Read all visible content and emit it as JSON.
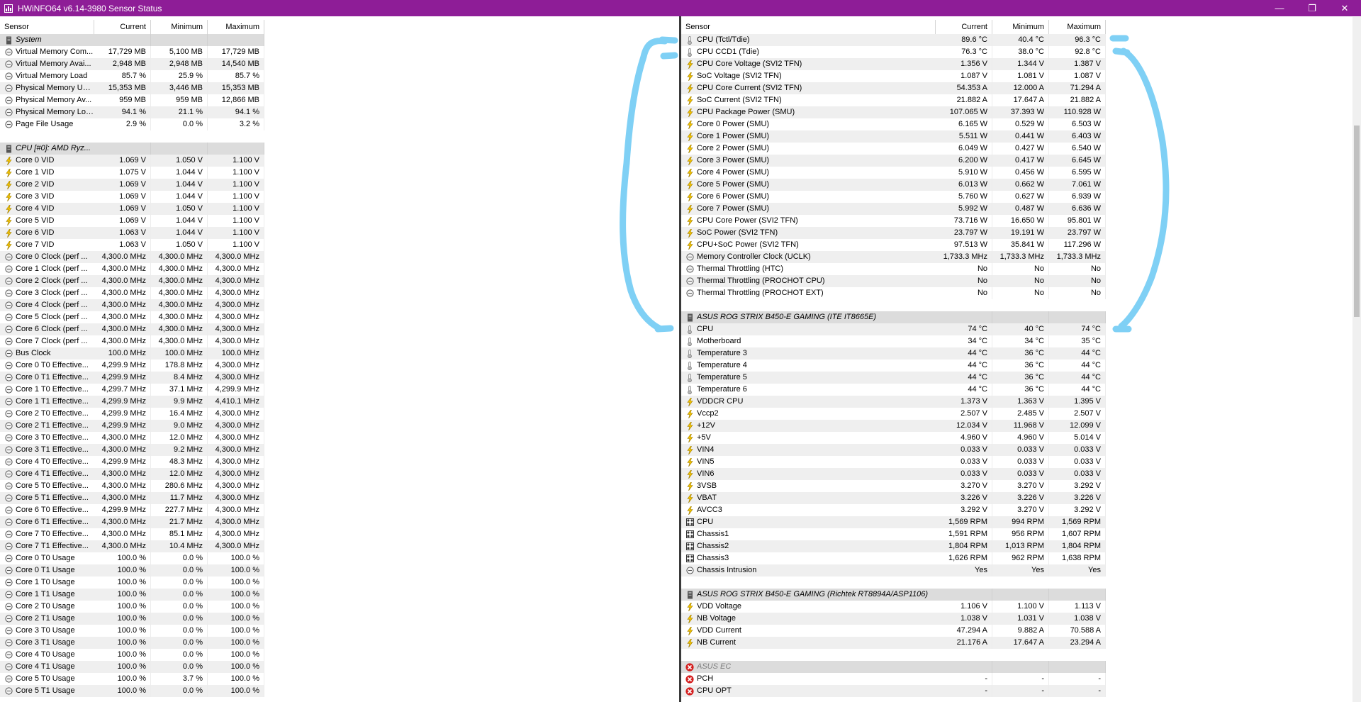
{
  "window": {
    "title": "HWiNFO64 v6.14-3980 Sensor Status"
  },
  "columns": {
    "sensor": "Sensor",
    "current": "Current",
    "minimum": "Minimum",
    "maximum": "Maximum"
  },
  "icon_names": {
    "mem": "memory-sensor-icon",
    "volt": "voltage-icon",
    "temp": "thermometer-icon",
    "fan": "fan-icon",
    "group": "sensor-group-icon",
    "err": "error-icon"
  },
  "left_rows": [
    {
      "type": "group",
      "label": "System"
    },
    {
      "icon": "mem",
      "label": "Virtual Memory Com...",
      "cur": "17,729 MB",
      "min": "5,100 MB",
      "max": "17,729 MB"
    },
    {
      "icon": "mem",
      "label": "Virtual Memory Avai...",
      "cur": "2,948 MB",
      "min": "2,948 MB",
      "max": "14,540 MB"
    },
    {
      "icon": "mem",
      "label": "Virtual Memory Load",
      "cur": "85.7 %",
      "min": "25.9 %",
      "max": "85.7 %"
    },
    {
      "icon": "mem",
      "label": "Physical Memory Used",
      "cur": "15,353 MB",
      "min": "3,446 MB",
      "max": "15,353 MB"
    },
    {
      "icon": "mem",
      "label": "Physical Memory Av...",
      "cur": "959 MB",
      "min": "959 MB",
      "max": "12,866 MB"
    },
    {
      "icon": "mem",
      "label": "Physical Memory Load",
      "cur": "94.1 %",
      "min": "21.1 %",
      "max": "94.1 %"
    },
    {
      "icon": "mem",
      "label": "Page File Usage",
      "cur": "2.9 %",
      "min": "0.0 %",
      "max": "3.2 %"
    },
    {
      "type": "spacer"
    },
    {
      "type": "group",
      "label": "CPU [#0]: AMD Ryz..."
    },
    {
      "icon": "volt",
      "label": "Core 0 VID",
      "cur": "1.069 V",
      "min": "1.050 V",
      "max": "1.100 V"
    },
    {
      "icon": "volt",
      "label": "Core 1 VID",
      "cur": "1.075 V",
      "min": "1.044 V",
      "max": "1.100 V"
    },
    {
      "icon": "volt",
      "label": "Core 2 VID",
      "cur": "1.069 V",
      "min": "1.044 V",
      "max": "1.100 V"
    },
    {
      "icon": "volt",
      "label": "Core 3 VID",
      "cur": "1.069 V",
      "min": "1.044 V",
      "max": "1.100 V"
    },
    {
      "icon": "volt",
      "label": "Core 4 VID",
      "cur": "1.069 V",
      "min": "1.050 V",
      "max": "1.100 V"
    },
    {
      "icon": "volt",
      "label": "Core 5 VID",
      "cur": "1.069 V",
      "min": "1.044 V",
      "max": "1.100 V"
    },
    {
      "icon": "volt",
      "label": "Core 6 VID",
      "cur": "1.063 V",
      "min": "1.044 V",
      "max": "1.100 V"
    },
    {
      "icon": "volt",
      "label": "Core 7 VID",
      "cur": "1.063 V",
      "min": "1.050 V",
      "max": "1.100 V"
    },
    {
      "icon": "mem",
      "label": "Core 0 Clock (perf ...",
      "cur": "4,300.0 MHz",
      "min": "4,300.0 MHz",
      "max": "4,300.0 MHz"
    },
    {
      "icon": "mem",
      "label": "Core 1 Clock (perf ...",
      "cur": "4,300.0 MHz",
      "min": "4,300.0 MHz",
      "max": "4,300.0 MHz"
    },
    {
      "icon": "mem",
      "label": "Core 2 Clock (perf ...",
      "cur": "4,300.0 MHz",
      "min": "4,300.0 MHz",
      "max": "4,300.0 MHz"
    },
    {
      "icon": "mem",
      "label": "Core 3 Clock (perf ...",
      "cur": "4,300.0 MHz",
      "min": "4,300.0 MHz",
      "max": "4,300.0 MHz"
    },
    {
      "icon": "mem",
      "label": "Core 4 Clock (perf ...",
      "cur": "4,300.0 MHz",
      "min": "4,300.0 MHz",
      "max": "4,300.0 MHz"
    },
    {
      "icon": "mem",
      "label": "Core 5 Clock (perf ...",
      "cur": "4,300.0 MHz",
      "min": "4,300.0 MHz",
      "max": "4,300.0 MHz"
    },
    {
      "icon": "mem",
      "label": "Core 6 Clock (perf ...",
      "cur": "4,300.0 MHz",
      "min": "4,300.0 MHz",
      "max": "4,300.0 MHz"
    },
    {
      "icon": "mem",
      "label": "Core 7 Clock (perf ...",
      "cur": "4,300.0 MHz",
      "min": "4,300.0 MHz",
      "max": "4,300.0 MHz"
    },
    {
      "icon": "mem",
      "label": "Bus Clock",
      "cur": "100.0 MHz",
      "min": "100.0 MHz",
      "max": "100.0 MHz"
    },
    {
      "icon": "mem",
      "label": "Core 0 T0 Effective...",
      "cur": "4,299.9 MHz",
      "min": "178.8 MHz",
      "max": "4,300.0 MHz"
    },
    {
      "icon": "mem",
      "label": "Core 0 T1 Effective...",
      "cur": "4,299.9 MHz",
      "min": "8.4 MHz",
      "max": "4,300.0 MHz"
    },
    {
      "icon": "mem",
      "label": "Core 1 T0 Effective...",
      "cur": "4,299.7 MHz",
      "min": "37.1 MHz",
      "max": "4,299.9 MHz"
    },
    {
      "icon": "mem",
      "label": "Core 1 T1 Effective...",
      "cur": "4,299.9 MHz",
      "min": "9.9 MHz",
      "max": "4,410.1 MHz"
    },
    {
      "icon": "mem",
      "label": "Core 2 T0 Effective...",
      "cur": "4,299.9 MHz",
      "min": "16.4 MHz",
      "max": "4,300.0 MHz"
    },
    {
      "icon": "mem",
      "label": "Core 2 T1 Effective...",
      "cur": "4,299.9 MHz",
      "min": "9.0 MHz",
      "max": "4,300.0 MHz"
    },
    {
      "icon": "mem",
      "label": "Core 3 T0 Effective...",
      "cur": "4,300.0 MHz",
      "min": "12.0 MHz",
      "max": "4,300.0 MHz"
    },
    {
      "icon": "mem",
      "label": "Core 3 T1 Effective...",
      "cur": "4,300.0 MHz",
      "min": "9.2 MHz",
      "max": "4,300.0 MHz"
    },
    {
      "icon": "mem",
      "label": "Core 4 T0 Effective...",
      "cur": "4,299.9 MHz",
      "min": "48.3 MHz",
      "max": "4,300.0 MHz"
    },
    {
      "icon": "mem",
      "label": "Core 4 T1 Effective...",
      "cur": "4,300.0 MHz",
      "min": "12.0 MHz",
      "max": "4,300.0 MHz"
    },
    {
      "icon": "mem",
      "label": "Core 5 T0 Effective...",
      "cur": "4,300.0 MHz",
      "min": "280.6 MHz",
      "max": "4,300.0 MHz"
    },
    {
      "icon": "mem",
      "label": "Core 5 T1 Effective...",
      "cur": "4,300.0 MHz",
      "min": "11.7 MHz",
      "max": "4,300.0 MHz"
    },
    {
      "icon": "mem",
      "label": "Core 6 T0 Effective...",
      "cur": "4,299.9 MHz",
      "min": "227.7 MHz",
      "max": "4,300.0 MHz"
    },
    {
      "icon": "mem",
      "label": "Core 6 T1 Effective...",
      "cur": "4,300.0 MHz",
      "min": "21.7 MHz",
      "max": "4,300.0 MHz"
    },
    {
      "icon": "mem",
      "label": "Core 7 T0 Effective...",
      "cur": "4,300.0 MHz",
      "min": "85.1 MHz",
      "max": "4,300.0 MHz"
    },
    {
      "icon": "mem",
      "label": "Core 7 T1 Effective...",
      "cur": "4,300.0 MHz",
      "min": "10.4 MHz",
      "max": "4,300.0 MHz"
    },
    {
      "icon": "mem",
      "label": "Core 0 T0 Usage",
      "cur": "100.0 %",
      "min": "0.0 %",
      "max": "100.0 %"
    },
    {
      "icon": "mem",
      "label": "Core 0 T1 Usage",
      "cur": "100.0 %",
      "min": "0.0 %",
      "max": "100.0 %"
    },
    {
      "icon": "mem",
      "label": "Core 1 T0 Usage",
      "cur": "100.0 %",
      "min": "0.0 %",
      "max": "100.0 %"
    },
    {
      "icon": "mem",
      "label": "Core 1 T1 Usage",
      "cur": "100.0 %",
      "min": "0.0 %",
      "max": "100.0 %"
    },
    {
      "icon": "mem",
      "label": "Core 2 T0 Usage",
      "cur": "100.0 %",
      "min": "0.0 %",
      "max": "100.0 %"
    },
    {
      "icon": "mem",
      "label": "Core 2 T1 Usage",
      "cur": "100.0 %",
      "min": "0.0 %",
      "max": "100.0 %"
    },
    {
      "icon": "mem",
      "label": "Core 3 T0 Usage",
      "cur": "100.0 %",
      "min": "0.0 %",
      "max": "100.0 %"
    },
    {
      "icon": "mem",
      "label": "Core 3 T1 Usage",
      "cur": "100.0 %",
      "min": "0.0 %",
      "max": "100.0 %"
    },
    {
      "icon": "mem",
      "label": "Core 4 T0 Usage",
      "cur": "100.0 %",
      "min": "0.0 %",
      "max": "100.0 %"
    },
    {
      "icon": "mem",
      "label": "Core 4 T1 Usage",
      "cur": "100.0 %",
      "min": "0.0 %",
      "max": "100.0 %"
    },
    {
      "icon": "mem",
      "label": "Core 5 T0 Usage",
      "cur": "100.0 %",
      "min": "3.7 %",
      "max": "100.0 %"
    },
    {
      "icon": "mem",
      "label": "Core 5 T1 Usage",
      "cur": "100.0 %",
      "min": "0.0 %",
      "max": "100.0 %"
    }
  ],
  "right_rows": [
    {
      "icon": "temp",
      "label": "CPU (Tctl/Tdie)",
      "cur": "89.6 °C",
      "min": "40.4 °C",
      "max": "96.3 °C"
    },
    {
      "icon": "temp",
      "label": "CPU CCD1 (Tdie)",
      "cur": "76.3 °C",
      "min": "38.0 °C",
      "max": "92.8 °C"
    },
    {
      "icon": "volt",
      "label": "CPU Core Voltage (SVI2 TFN)",
      "cur": "1.356 V",
      "min": "1.344 V",
      "max": "1.387 V"
    },
    {
      "icon": "volt",
      "label": "SoC Voltage (SVI2 TFN)",
      "cur": "1.087 V",
      "min": "1.081 V",
      "max": "1.087 V"
    },
    {
      "icon": "volt",
      "label": "CPU Core Current (SVI2 TFN)",
      "cur": "54.353 A",
      "min": "12.000 A",
      "max": "71.294 A"
    },
    {
      "icon": "volt",
      "label": "SoC Current (SVI2 TFN)",
      "cur": "21.882 A",
      "min": "17.647 A",
      "max": "21.882 A"
    },
    {
      "icon": "volt",
      "label": "CPU Package Power (SMU)",
      "cur": "107.065 W",
      "min": "37.393 W",
      "max": "110.928 W"
    },
    {
      "icon": "volt",
      "label": "Core 0 Power (SMU)",
      "cur": "6.165 W",
      "min": "0.529 W",
      "max": "6.503 W"
    },
    {
      "icon": "volt",
      "label": "Core 1 Power (SMU)",
      "cur": "5.511 W",
      "min": "0.441 W",
      "max": "6.403 W"
    },
    {
      "icon": "volt",
      "label": "Core 2 Power (SMU)",
      "cur": "6.049 W",
      "min": "0.427 W",
      "max": "6.540 W"
    },
    {
      "icon": "volt",
      "label": "Core 3 Power (SMU)",
      "cur": "6.200 W",
      "min": "0.417 W",
      "max": "6.645 W"
    },
    {
      "icon": "volt",
      "label": "Core 4 Power (SMU)",
      "cur": "5.910 W",
      "min": "0.456 W",
      "max": "6.595 W"
    },
    {
      "icon": "volt",
      "label": "Core 5 Power (SMU)",
      "cur": "6.013 W",
      "min": "0.662 W",
      "max": "7.061 W"
    },
    {
      "icon": "volt",
      "label": "Core 6 Power (SMU)",
      "cur": "5.760 W",
      "min": "0.627 W",
      "max": "6.939 W"
    },
    {
      "icon": "volt",
      "label": "Core 7 Power (SMU)",
      "cur": "5.992 W",
      "min": "0.487 W",
      "max": "6.636 W"
    },
    {
      "icon": "volt",
      "label": "CPU Core Power (SVI2 TFN)",
      "cur": "73.716 W",
      "min": "16.650 W",
      "max": "95.801 W"
    },
    {
      "icon": "volt",
      "label": "SoC Power (SVI2 TFN)",
      "cur": "23.797 W",
      "min": "19.191 W",
      "max": "23.797 W"
    },
    {
      "icon": "volt",
      "label": "CPU+SoC Power (SVI2 TFN)",
      "cur": "97.513 W",
      "min": "35.841 W",
      "max": "117.296 W"
    },
    {
      "icon": "mem",
      "label": "Memory Controller Clock (UCLK)",
      "cur": "1,733.3 MHz",
      "min": "1,733.3 MHz",
      "max": "1,733.3 MHz"
    },
    {
      "icon": "mem",
      "label": "Thermal Throttling (HTC)",
      "cur": "No",
      "min": "No",
      "max": "No"
    },
    {
      "icon": "mem",
      "label": "Thermal Throttling (PROCHOT CPU)",
      "cur": "No",
      "min": "No",
      "max": "No"
    },
    {
      "icon": "mem",
      "label": "Thermal Throttling (PROCHOT EXT)",
      "cur": "No",
      "min": "No",
      "max": "No"
    },
    {
      "type": "spacer"
    },
    {
      "type": "group",
      "label": "ASUS ROG STRIX B450-E GAMING (ITE IT8665E)"
    },
    {
      "icon": "temp",
      "label": "CPU",
      "cur": "74 °C",
      "min": "40 °C",
      "max": "74 °C"
    },
    {
      "icon": "temp",
      "label": "Motherboard",
      "cur": "34 °C",
      "min": "34 °C",
      "max": "35 °C"
    },
    {
      "icon": "temp",
      "label": "Temperature 3",
      "cur": "44 °C",
      "min": "36 °C",
      "max": "44 °C"
    },
    {
      "icon": "temp",
      "label": "Temperature 4",
      "cur": "44 °C",
      "min": "36 °C",
      "max": "44 °C"
    },
    {
      "icon": "temp",
      "label": "Temperature 5",
      "cur": "44 °C",
      "min": "36 °C",
      "max": "44 °C"
    },
    {
      "icon": "temp",
      "label": "Temperature 6",
      "cur": "44 °C",
      "min": "36 °C",
      "max": "44 °C"
    },
    {
      "icon": "volt",
      "label": "VDDCR CPU",
      "cur": "1.373 V",
      "min": "1.363 V",
      "max": "1.395 V"
    },
    {
      "icon": "volt",
      "label": "Vccp2",
      "cur": "2.507 V",
      "min": "2.485 V",
      "max": "2.507 V"
    },
    {
      "icon": "volt",
      "label": "+12V",
      "cur": "12.034 V",
      "min": "11.968 V",
      "max": "12.099 V"
    },
    {
      "icon": "volt",
      "label": "+5V",
      "cur": "4.960 V",
      "min": "4.960 V",
      "max": "5.014 V"
    },
    {
      "icon": "volt",
      "label": "VIN4",
      "cur": "0.033 V",
      "min": "0.033 V",
      "max": "0.033 V"
    },
    {
      "icon": "volt",
      "label": "VIN5",
      "cur": "0.033 V",
      "min": "0.033 V",
      "max": "0.033 V"
    },
    {
      "icon": "volt",
      "label": "VIN6",
      "cur": "0.033 V",
      "min": "0.033 V",
      "max": "0.033 V"
    },
    {
      "icon": "volt",
      "label": "3VSB",
      "cur": "3.270 V",
      "min": "3.270 V",
      "max": "3.292 V"
    },
    {
      "icon": "volt",
      "label": "VBAT",
      "cur": "3.226 V",
      "min": "3.226 V",
      "max": "3.226 V"
    },
    {
      "icon": "volt",
      "label": "AVCC3",
      "cur": "3.292 V",
      "min": "3.270 V",
      "max": "3.292 V"
    },
    {
      "icon": "fan",
      "label": "CPU",
      "cur": "1,569 RPM",
      "min": "994 RPM",
      "max": "1,569 RPM"
    },
    {
      "icon": "fan",
      "label": "Chassis1",
      "cur": "1,591 RPM",
      "min": "956 RPM",
      "max": "1,607 RPM"
    },
    {
      "icon": "fan",
      "label": "Chassis2",
      "cur": "1,804 RPM",
      "min": "1,013 RPM",
      "max": "1,804 RPM"
    },
    {
      "icon": "fan",
      "label": "Chassis3",
      "cur": "1,626 RPM",
      "min": "962 RPM",
      "max": "1,638 RPM"
    },
    {
      "icon": "mem",
      "label": "Chassis Intrusion",
      "cur": "Yes",
      "min": "Yes",
      "max": "Yes"
    },
    {
      "type": "spacer"
    },
    {
      "type": "group",
      "label": "ASUS ROG STRIX B450-E GAMING (Richtek RT8894A/ASP1106)"
    },
    {
      "icon": "volt",
      "label": "VDD Voltage",
      "cur": "1.106 V",
      "min": "1.100 V",
      "max": "1.113 V"
    },
    {
      "icon": "volt",
      "label": "NB Voltage",
      "cur": "1.038 V",
      "min": "1.031 V",
      "max": "1.038 V"
    },
    {
      "icon": "volt",
      "label": "VDD Current",
      "cur": "47.294 A",
      "min": "9.882 A",
      "max": "70.588 A"
    },
    {
      "icon": "volt",
      "label": "NB Current",
      "cur": "21.176 A",
      "min": "17.647 A",
      "max": "23.294 A"
    },
    {
      "type": "spacer"
    },
    {
      "type": "group",
      "icon": "err",
      "label": "ASUS EC",
      "disabled": true
    },
    {
      "icon": "err",
      "label": "PCH",
      "cur": "-",
      "min": "-",
      "max": "-"
    },
    {
      "icon": "err",
      "label": "CPU OPT",
      "cur": "-",
      "min": "-",
      "max": "-"
    }
  ],
  "colors": {
    "titlebar": "#8e1d97",
    "annotation": "#7fd0f5",
    "group_bg": "#dcdcdc",
    "row_alt": "#efefef"
  }
}
